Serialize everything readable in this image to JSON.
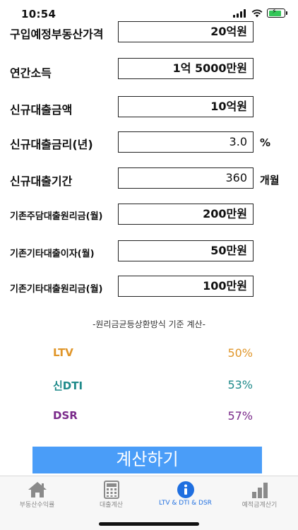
{
  "status_bar": {
    "time": "10:54"
  },
  "form": {
    "rows": [
      {
        "label": "구입예정부동산가격",
        "value": "20억원"
      },
      {
        "label": "연간소득",
        "value": "1억 5000만원"
      },
      {
        "label": "신규대출금액",
        "value": "10억원"
      },
      {
        "label": "신규대출금리(년)",
        "value": "3.0",
        "unit": "%"
      },
      {
        "label": "신규대출기간",
        "value": "360",
        "unit": "개월"
      },
      {
        "label": "기존주담대출원리금(월)",
        "value": "200만원"
      },
      {
        "label": "기존기타대출이자(월)",
        "value": "50만원"
      },
      {
        "label": "기존기타대출원리금(월)",
        "value": "100만원"
      }
    ]
  },
  "method_note": "-원리금균등상환방식 기준 계산-",
  "results": [
    {
      "label": "LTV",
      "value": "50%",
      "color": "#e0962a"
    },
    {
      "label": "신DTI",
      "value": "53%",
      "color": "#1f8a8a"
    },
    {
      "label": "DSR",
      "value": "57%",
      "color": "#7a2a8a"
    }
  ],
  "calc_button_label": "계산하기",
  "tabs": [
    {
      "label": "부동산수익률",
      "icon": "house-icon",
      "active": false
    },
    {
      "label": "대출계산",
      "icon": "calculator-icon",
      "active": false
    },
    {
      "label": "LTV & DTI & DSR",
      "icon": "info-icon",
      "active": true
    },
    {
      "label": "예적금계산기",
      "icon": "bar-chart-icon",
      "active": false
    }
  ],
  "colors": {
    "accent": "#4a9df8",
    "active_tab": "#1f6fe0",
    "inactive_tab": "#888888"
  }
}
